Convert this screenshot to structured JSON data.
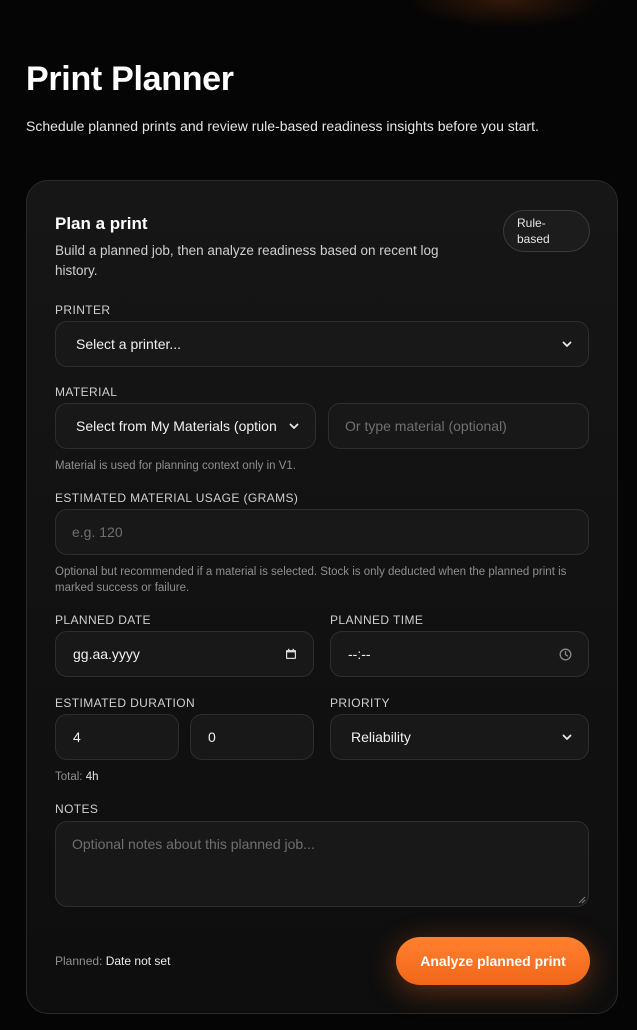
{
  "page": {
    "title": "Print Planner",
    "subtitle": "Schedule planned prints and review rule-based readiness insights before you start."
  },
  "card": {
    "title": "Plan a print",
    "description": "Build a planned job, then analyze readiness based on recent log history.",
    "badge_line1": "Rule-",
    "badge_line2": "based"
  },
  "printer": {
    "label": "PRINTER",
    "selected": "Select a printer..."
  },
  "material": {
    "label": "MATERIAL",
    "select_value": "Select from My Materials (option",
    "input_placeholder": "Or type material (optional)",
    "hint": "Material is used for planning context only in V1."
  },
  "usage": {
    "label": "ESTIMATED MATERIAL USAGE (GRAMS)",
    "placeholder": "e.g. 120",
    "hint": "Optional but recommended if a material is selected. Stock is only deducted when the planned print is marked success or failure."
  },
  "date": {
    "label": "PLANNED DATE",
    "value": "gg.aa.yyyy"
  },
  "time": {
    "label": "PLANNED TIME",
    "value": "--:--"
  },
  "duration": {
    "label": "ESTIMATED DURATION",
    "hours": "4",
    "minutes": "0",
    "total_label": "Total:",
    "total_value": "4h"
  },
  "priority": {
    "label": "PRIORITY",
    "selected": "Reliability"
  },
  "notes": {
    "label": "NOTES",
    "placeholder": "Optional notes about this planned job..."
  },
  "footer": {
    "planned_label": "Planned:",
    "planned_value": "Date not set",
    "cta_label": "Analyze planned print"
  },
  "colors": {
    "accent": "#f7711f",
    "background": "#050505",
    "card": "#141414",
    "field": "#181818"
  }
}
